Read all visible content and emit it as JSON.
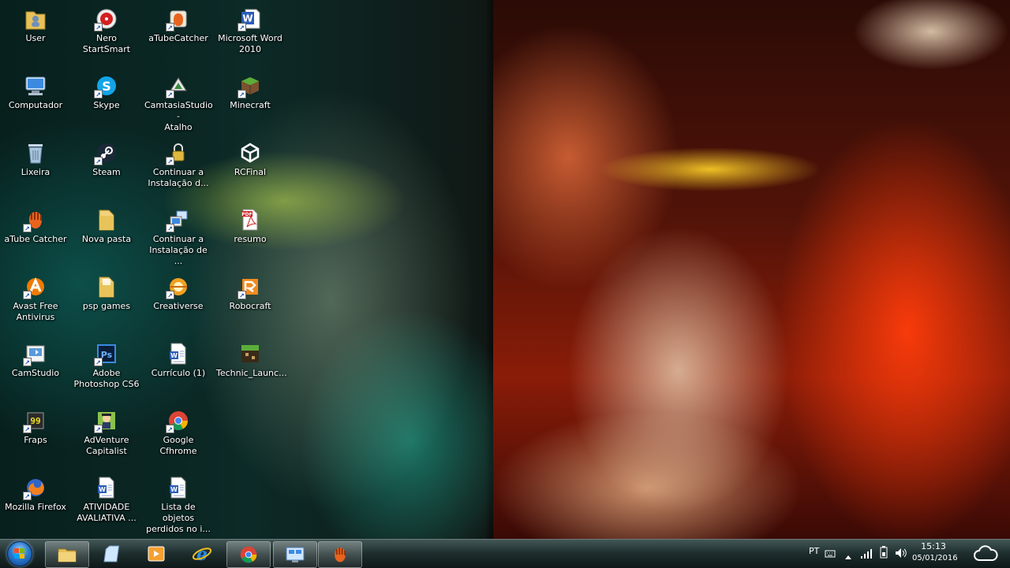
{
  "desktop": {
    "icons": [
      {
        "label": "User",
        "icon": "user-folder-icon"
      },
      {
        "label": "Computador",
        "icon": "computer-icon"
      },
      {
        "label": "Lixeira",
        "icon": "recycle-bin-icon"
      },
      {
        "label": "aTube Catcher",
        "icon": "atube-catcher-icon"
      },
      {
        "label": "Avast Free\nAntivirus",
        "icon": "avast-icon"
      },
      {
        "label": "CamStudio",
        "icon": "camstudio-icon"
      },
      {
        "label": "Fraps",
        "icon": "fraps-icon"
      },
      {
        "label": "Mozilla Firefox",
        "icon": "firefox-icon"
      },
      {
        "label": "Nero StartSmart",
        "icon": "nero-icon"
      },
      {
        "label": "Skype",
        "icon": "skype-icon"
      },
      {
        "label": "Steam",
        "icon": "steam-icon"
      },
      {
        "label": "Nova pasta",
        "icon": "folder-icon"
      },
      {
        "label": "psp games",
        "icon": "folder-icon"
      },
      {
        "label": "Adobe\nPhotoshop CS6",
        "icon": "photoshop-icon"
      },
      {
        "label": "AdVenture\nCapitalist",
        "icon": "adventure-capitalist-icon"
      },
      {
        "label": "ATIVIDADE\nAVALIATIVA ...",
        "icon": "word-doc-icon"
      },
      {
        "label": "aTubeCatcher",
        "icon": "atube-catcher-icon"
      },
      {
        "label": "CamtasiaStudio -\nAtalho",
        "icon": "camtasia-icon"
      },
      {
        "label": "Continuar a\nInstalação d...",
        "icon": "lock-installer-icon"
      },
      {
        "label": "Continuar a\nInstalação de ...",
        "icon": "installer-icon"
      },
      {
        "label": "Creativerse",
        "icon": "creativerse-icon"
      },
      {
        "label": "Currículo (1)",
        "icon": "word-doc-icon"
      },
      {
        "label": "Google Cfhrome",
        "icon": "chrome-icon"
      },
      {
        "label": "Lista de objetos\nperdidos no i...",
        "icon": "word-doc-icon"
      },
      {
        "label": "Microsoft Word\n2010",
        "icon": "word-icon"
      },
      {
        "label": "Minecraft",
        "icon": "minecraft-icon"
      },
      {
        "label": "RCFinal",
        "icon": "unity-icon"
      },
      {
        "label": "resumo",
        "icon": "pdf-icon"
      },
      {
        "label": "Robocraft",
        "icon": "robocraft-icon"
      },
      {
        "label": "Technic_Launc...",
        "icon": "technic-launcher-icon"
      }
    ]
  },
  "taskbar": {
    "pinned": [
      {
        "name": "explorer-icon"
      },
      {
        "name": "notepad-icon"
      },
      {
        "name": "media-player-icon"
      },
      {
        "name": "internet-explorer-icon"
      },
      {
        "name": "chrome-icon"
      },
      {
        "name": "control-panel-icon"
      },
      {
        "name": "atube-catcher-icon"
      }
    ],
    "language": "PT",
    "time": "15:13",
    "date": "05/01/2016"
  }
}
